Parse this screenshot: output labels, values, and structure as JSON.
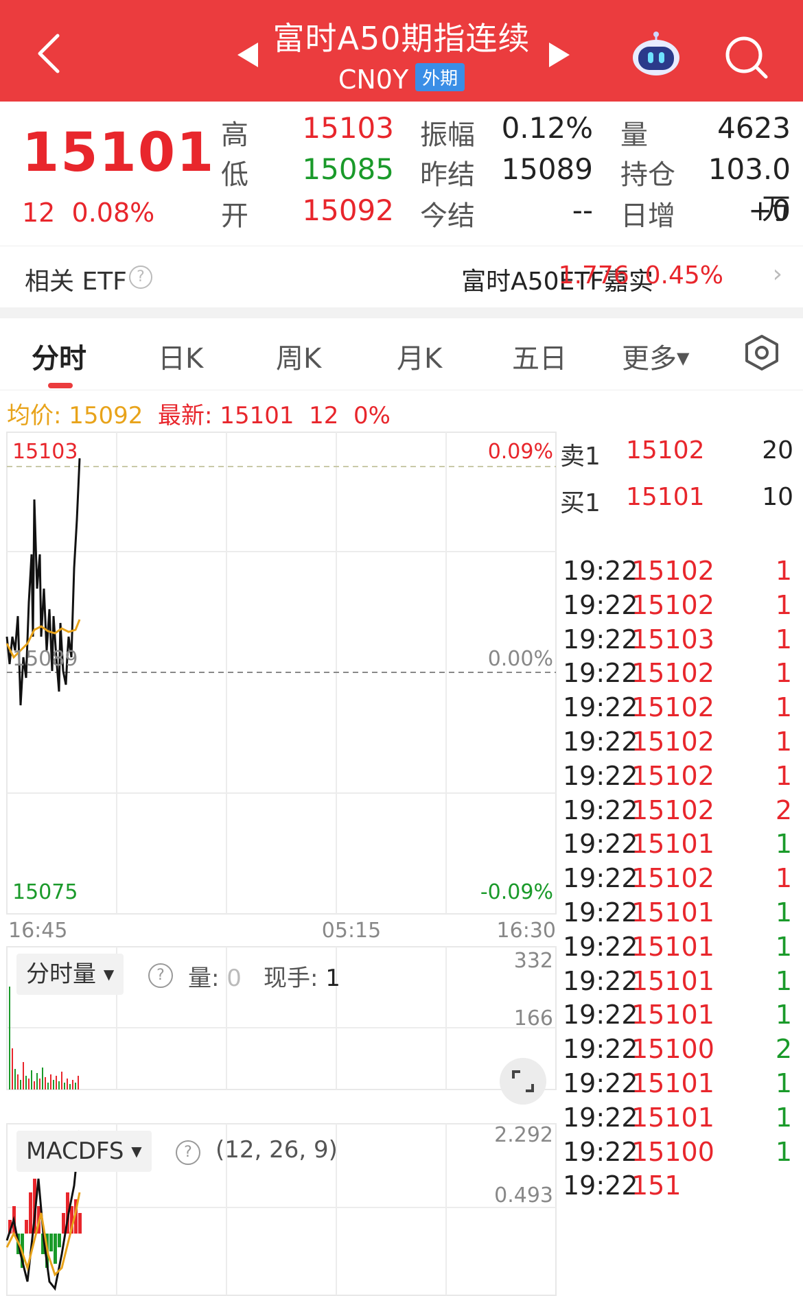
{
  "header": {
    "title": "富时A50期指连续",
    "code": "CN0Y",
    "market_tag": "外期",
    "colors": {
      "bg": "#eb3c3e"
    }
  },
  "quote": {
    "last": "15101",
    "change": "12",
    "change_pct": "0.08%",
    "fields": {
      "high_label": "高",
      "high": "15103",
      "low_label": "低",
      "low": "15085",
      "open_label": "开",
      "open": "15092",
      "amp_label": "振幅",
      "amp": "0.12%",
      "prev_settle_label": "昨结",
      "prev_settle": "15089",
      "settle_label": "今结",
      "settle": "--",
      "vol_label": "量",
      "vol": "4623",
      "oi_label": "持仓",
      "oi": "103.0万",
      "oi_chg_label": "日增",
      "oi_chg": "+0"
    }
  },
  "etf": {
    "label": "相关 ETF",
    "name": "富时A50ETF嘉实",
    "price": "1.776",
    "pct": "0.45%"
  },
  "tabs": [
    "分时",
    "日K",
    "周K",
    "月K",
    "五日",
    "更多"
  ],
  "info_line": {
    "avg_label": "均价: 15092",
    "latest_label": "最新: 15101",
    "chg": "12",
    "pct": "0%"
  },
  "chart": {
    "y_top": "15103",
    "y_mid": "15089",
    "y_bot": "15075",
    "pct_top": "0.09%",
    "pct_mid": "0.00%",
    "pct_bot": "-0.09%",
    "x_labels": [
      "16:45",
      "05:15",
      "16:30"
    ]
  },
  "volume_panel": {
    "selector": "分时量",
    "vol_label": "量:",
    "vol_value": "0",
    "hand_label": "现手:",
    "hand_value": "1",
    "y_top": "332",
    "y_mid": "166"
  },
  "macd_panel": {
    "selector": "MACDFS",
    "params": "(12, 26, 9)",
    "y_top": "2.292",
    "y_mid": "0.493"
  },
  "order_book": [
    {
      "label": "卖1",
      "price": "15102",
      "vol": "20"
    },
    {
      "label": "买1",
      "price": "15101",
      "vol": "10"
    }
  ],
  "ticks": [
    {
      "time": "19:22",
      "price": "15102",
      "vol": "1",
      "pc": "red",
      "vc": "red"
    },
    {
      "time": "19:22",
      "price": "15102",
      "vol": "1",
      "pc": "red",
      "vc": "red"
    },
    {
      "time": "19:22",
      "price": "15103",
      "vol": "1",
      "pc": "red",
      "vc": "red"
    },
    {
      "time": "19:22",
      "price": "15102",
      "vol": "1",
      "pc": "red",
      "vc": "red"
    },
    {
      "time": "19:22",
      "price": "15102",
      "vol": "1",
      "pc": "red",
      "vc": "red"
    },
    {
      "time": "19:22",
      "price": "15102",
      "vol": "1",
      "pc": "red",
      "vc": "red"
    },
    {
      "time": "19:22",
      "price": "15102",
      "vol": "1",
      "pc": "red",
      "vc": "red"
    },
    {
      "time": "19:22",
      "price": "15102",
      "vol": "2",
      "pc": "red",
      "vc": "red"
    },
    {
      "time": "19:22",
      "price": "15101",
      "vol": "1",
      "pc": "red",
      "vc": "green"
    },
    {
      "time": "19:22",
      "price": "15102",
      "vol": "1",
      "pc": "red",
      "vc": "red"
    },
    {
      "time": "19:22",
      "price": "15101",
      "vol": "1",
      "pc": "red",
      "vc": "green"
    },
    {
      "time": "19:22",
      "price": "15101",
      "vol": "1",
      "pc": "red",
      "vc": "green"
    },
    {
      "time": "19:22",
      "price": "15101",
      "vol": "1",
      "pc": "red",
      "vc": "green"
    },
    {
      "time": "19:22",
      "price": "15101",
      "vol": "1",
      "pc": "red",
      "vc": "green"
    },
    {
      "time": "19:22",
      "price": "15100",
      "vol": "2",
      "pc": "red",
      "vc": "green"
    },
    {
      "time": "19:22",
      "price": "15101",
      "vol": "1",
      "pc": "red",
      "vc": "green"
    },
    {
      "time": "19:22",
      "price": "15101",
      "vol": "1",
      "pc": "red",
      "vc": "green"
    },
    {
      "time": "19:22",
      "price": "15100",
      "vol": "1",
      "pc": "red",
      "vc": "green"
    },
    {
      "time": "19:22",
      "price": "151",
      "vol": "",
      "pc": "red",
      "vc": "green"
    }
  ],
  "icons": {
    "back": "chevron-left-icon",
    "prev": "triangle-left-icon",
    "next": "triangle-right-icon",
    "robot": "robot-icon",
    "search": "search-icon",
    "settings": "settings-hex-icon",
    "expand": "expand-icon"
  }
}
